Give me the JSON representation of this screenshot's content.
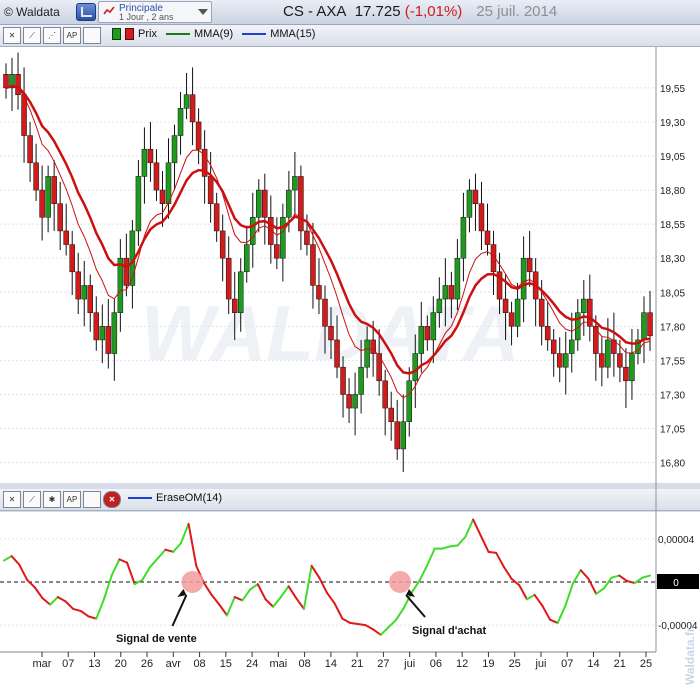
{
  "app": {
    "title": "© Waldata"
  },
  "selector": {
    "line1": "Principale",
    "line2": "1 Jour , 2 ans"
  },
  "header": {
    "symbol": "CS - AXA",
    "price": "17.725",
    "change": "(-1,01%)",
    "date": "25 juil. 2014"
  },
  "legend_top": {
    "price": "Prix",
    "ma1": "MMA(9)",
    "ma2": "MMA(15)"
  },
  "legend_bottom": {
    "indicator": "EraseOM(14)"
  },
  "colors": {
    "up": "#1f9a1f",
    "down": "#d01c1c",
    "ma9": "#cc1010",
    "ma15": "#1a7a1a",
    "blue_line": "#1f3fd0"
  },
  "watermark": "WALDATA",
  "side_watermark": "Waldata.fr",
  "annotations": {
    "sell": "Signal de vente",
    "buy": "Signal d'achat"
  },
  "chart_data": [
    {
      "type": "candlestick",
      "ylim": [
        16.65,
        19.85
      ],
      "yticks": [
        "19,55",
        "19,30",
        "19,05",
        "18,80",
        "18,55",
        "18,30",
        "18,05",
        "17,80",
        "17,55",
        "17,30",
        "17,05",
        "16,80"
      ],
      "ytick_values": [
        19.55,
        19.3,
        19.05,
        18.8,
        18.55,
        18.3,
        18.05,
        17.8,
        17.55,
        17.3,
        17.05,
        16.8
      ],
      "close": [
        19.55,
        19.65,
        19.5,
        19.2,
        19.0,
        18.8,
        18.6,
        18.9,
        18.7,
        18.5,
        18.4,
        18.2,
        18.0,
        18.1,
        17.9,
        17.7,
        17.8,
        17.6,
        17.9,
        18.3,
        18.1,
        18.5,
        18.9,
        19.1,
        19.0,
        18.8,
        18.7,
        19.0,
        19.2,
        19.4,
        19.5,
        19.3,
        19.1,
        18.9,
        18.7,
        18.5,
        18.3,
        18.0,
        17.9,
        18.2,
        18.4,
        18.6,
        18.8,
        18.6,
        18.4,
        18.3,
        18.6,
        18.8,
        18.9,
        18.5,
        18.4,
        18.1,
        18.0,
        17.8,
        17.7,
        17.5,
        17.3,
        17.2,
        17.3,
        17.5,
        17.7,
        17.6,
        17.4,
        17.2,
        17.1,
        16.9,
        17.1,
        17.4,
        17.6,
        17.8,
        17.7,
        17.9,
        18.0,
        18.1,
        18.0,
        18.3,
        18.6,
        18.8,
        18.7,
        18.5,
        18.4,
        18.2,
        18.0,
        17.9,
        17.8,
        18.0,
        18.3,
        18.2,
        18.0,
        17.8,
        17.7,
        17.6,
        17.5,
        17.6,
        17.7,
        17.9,
        18.0,
        17.8,
        17.6,
        17.5,
        17.7,
        17.6,
        17.5,
        17.4,
        17.6,
        17.7,
        17.9,
        17.73
      ],
      "series": [
        {
          "name": "MMA(9)"
        },
        {
          "name": "MMA(15)"
        }
      ],
      "x_ticks": [
        "mar",
        "07",
        "13",
        "20",
        "26",
        "avr",
        "08",
        "15",
        "24",
        "mai",
        "08",
        "14",
        "21",
        "27",
        "jui",
        "06",
        "12",
        "19",
        "25",
        "jui",
        "07",
        "14",
        "21",
        "25"
      ]
    },
    {
      "type": "line",
      "name": "EraseOM(14)",
      "yticks": [
        "0,00004",
        "0",
        "-0,00004"
      ],
      "ytick_values": [
        4e-05,
        0,
        -4e-05
      ],
      "ylim": [
        -6.5e-05,
        6.5e-05
      ],
      "values": [
        2e-05,
        2.4e-05,
        1.6e-05,
        2e-06,
        -5e-06,
        -1.5e-05,
        -2.1e-05,
        -1.4e-05,
        -1.8e-05,
        -2.5e-05,
        -2.7e-05,
        -3.2e-05,
        -3.4e-05,
        -1.6e-05,
        6e-06,
        2.1e-05,
        1.8e-05,
        -2e-06,
        2e-06,
        1.4e-05,
        2.2e-05,
        3e-05,
        2.8e-05,
        3.6e-05,
        5.4e-05,
        1.5e-05,
        -1e-06,
        -1.2e-05,
        -2.1e-05,
        -3.1e-05,
        -1.4e-05,
        -1.7e-05,
        -7e-06,
        -2e-06,
        -1.6e-05,
        -2.3e-05,
        -1.4e-05,
        -4e-06,
        -1.5e-05,
        -2.5e-05,
        1.5e-05,
        4e-06,
        -1e-05,
        -2e-05,
        -3.4e-05,
        -3.8e-05,
        -3.9e-05,
        -4e-05,
        -4.4e-05,
        -4.9e-05,
        -4.2e-05,
        -3.5e-05,
        -2.4e-05,
        -1e-05,
        1e-06,
        1.5e-05,
        3.1e-05,
        3.1e-05,
        3.3e-05,
        3.4e-05,
        4.2e-05,
        5.8e-05,
        4.3e-05,
        2.8e-05,
        2.7e-05,
        1.4e-05,
        3e-06,
        -3e-06,
        -1.6e-05,
        -1.2e-05,
        -2.2e-05,
        -3.5e-05,
        -3.8e-05,
        -2.2e-05,
        -1e-06,
        1.1e-05,
        3e-06,
        -1.1e-05,
        -6e-06,
        4e-06,
        6e-06,
        1e-06,
        -1e-06,
        4e-06,
        6e-06
      ]
    }
  ]
}
